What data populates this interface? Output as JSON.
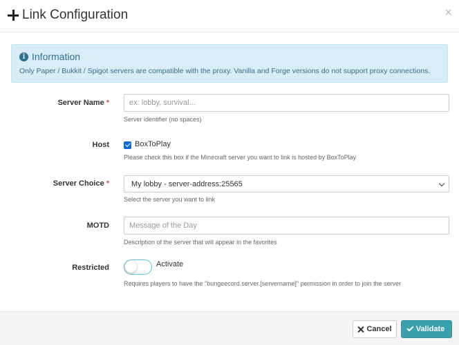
{
  "modal": {
    "title": "Link Configuration",
    "close_symbol": "×"
  },
  "alert": {
    "heading": "Information",
    "text": "Only Paper / Bukkit / Spigot servers are compatible with the proxy. Vanilla and Forge versions do not support proxy connections."
  },
  "form": {
    "server_name": {
      "label": "Server Name",
      "required_mark": "*",
      "value": "",
      "placeholder": "ex: lobby, survival...",
      "help": "Server identifier (no spaces)"
    },
    "host": {
      "label": "Host",
      "checkbox_label": "BoxToPlay",
      "checked": true,
      "help": "Please check this box if the Minecraft server you want to link is hosted by BoxToPlay"
    },
    "server_choice": {
      "label": "Server Choice",
      "required_mark": "*",
      "selected": "My lobby - server-address:25565",
      "help": "Select the server you want to link"
    },
    "motd": {
      "label": "MOTD",
      "value": "",
      "placeholder": "Message of the Day",
      "help": "Description of the server that will appear in the favorites"
    },
    "restricted": {
      "label": "Restricted",
      "toggle_label": "Activate",
      "on": false,
      "help": "Requires players to have the \"bungeecord.server.[servername]\" permission in order to join the server"
    }
  },
  "footer": {
    "cancel_label": "Cancel",
    "validate_label": "Validate"
  },
  "colors": {
    "accent": "#3aa0ab",
    "info_bg": "#d9edf7",
    "info_text": "#31708f",
    "required": "#d9534f",
    "checkbox": "#0b6bd3"
  },
  "icons": [
    "plus-icon",
    "close-icon",
    "info-icon",
    "chevron-down-icon",
    "check-icon"
  ]
}
